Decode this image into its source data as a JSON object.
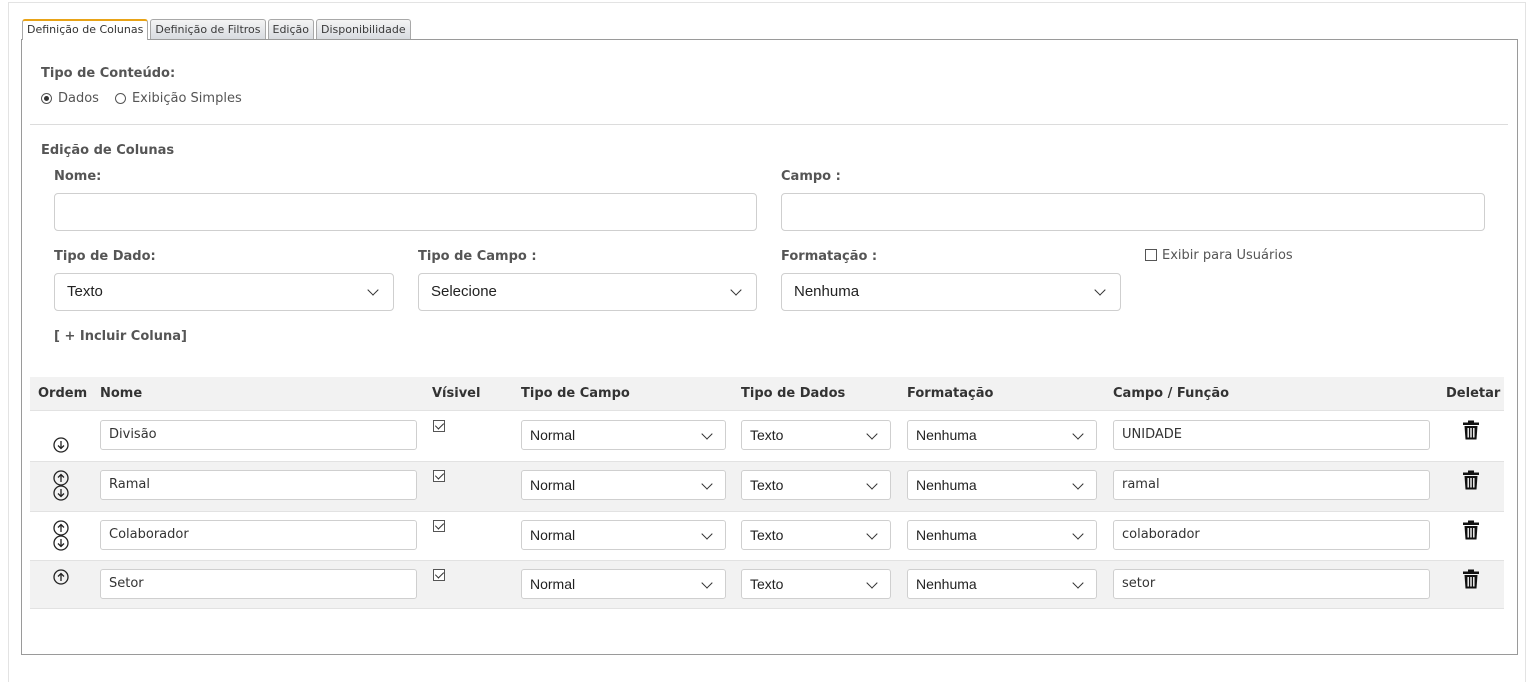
{
  "tabs": [
    {
      "label": "Definição de Colunas",
      "active": true
    },
    {
      "label": "Definição de Filtros",
      "active": false
    },
    {
      "label": "Edição",
      "active": false
    },
    {
      "label": "Disponibilidade",
      "active": false
    }
  ],
  "content_type": {
    "label": "Tipo de Conteúdo:",
    "options": [
      {
        "label": "Dados",
        "selected": true
      },
      {
        "label": "Exibição Simples",
        "selected": false
      }
    ]
  },
  "column_edit": {
    "section_title": "Edição de Colunas",
    "name_label": "Nome:",
    "name_value": "",
    "field_label": "Campo :",
    "field_value": "",
    "data_type_label": "Tipo de Dado:",
    "data_type_value": "Texto",
    "field_type_label": "Tipo de Campo :",
    "field_type_value": "Selecione",
    "format_label": "Formatação :",
    "format_value": "Nenhuma",
    "show_users_label": "Exibir para Usuários",
    "show_users_checked": false,
    "add_column_label": "[ + Incluir Coluna]"
  },
  "table": {
    "headers": {
      "order": "Ordem",
      "name": "Nome",
      "visible": "Vísivel",
      "field_type": "Tipo de Campo",
      "data_type": "Tipo de Dados",
      "format": "Formatação",
      "field_function": "Campo / Função",
      "delete": "Deletar"
    },
    "rows": [
      {
        "name": "Divisão",
        "visible": true,
        "field_type": "Normal",
        "data_type": "Texto",
        "format": "Nenhuma",
        "field": "UNIDADE",
        "up": false,
        "down": true
      },
      {
        "name": "Ramal",
        "visible": true,
        "field_type": "Normal",
        "data_type": "Texto",
        "format": "Nenhuma",
        "field": "ramal",
        "up": true,
        "down": true
      },
      {
        "name": "Colaborador",
        "visible": true,
        "field_type": "Normal",
        "data_type": "Texto",
        "format": "Nenhuma",
        "field": "colaborador",
        "up": true,
        "down": true
      },
      {
        "name": "Setor",
        "visible": true,
        "field_type": "Normal",
        "data_type": "Texto",
        "format": "Nenhuma",
        "field": "setor",
        "up": true,
        "down": false
      }
    ]
  },
  "colors": {
    "active_tab_accent": "#e8a317",
    "alt_row": "#f2f2f2",
    "panel_border": "#9a9a9a"
  }
}
